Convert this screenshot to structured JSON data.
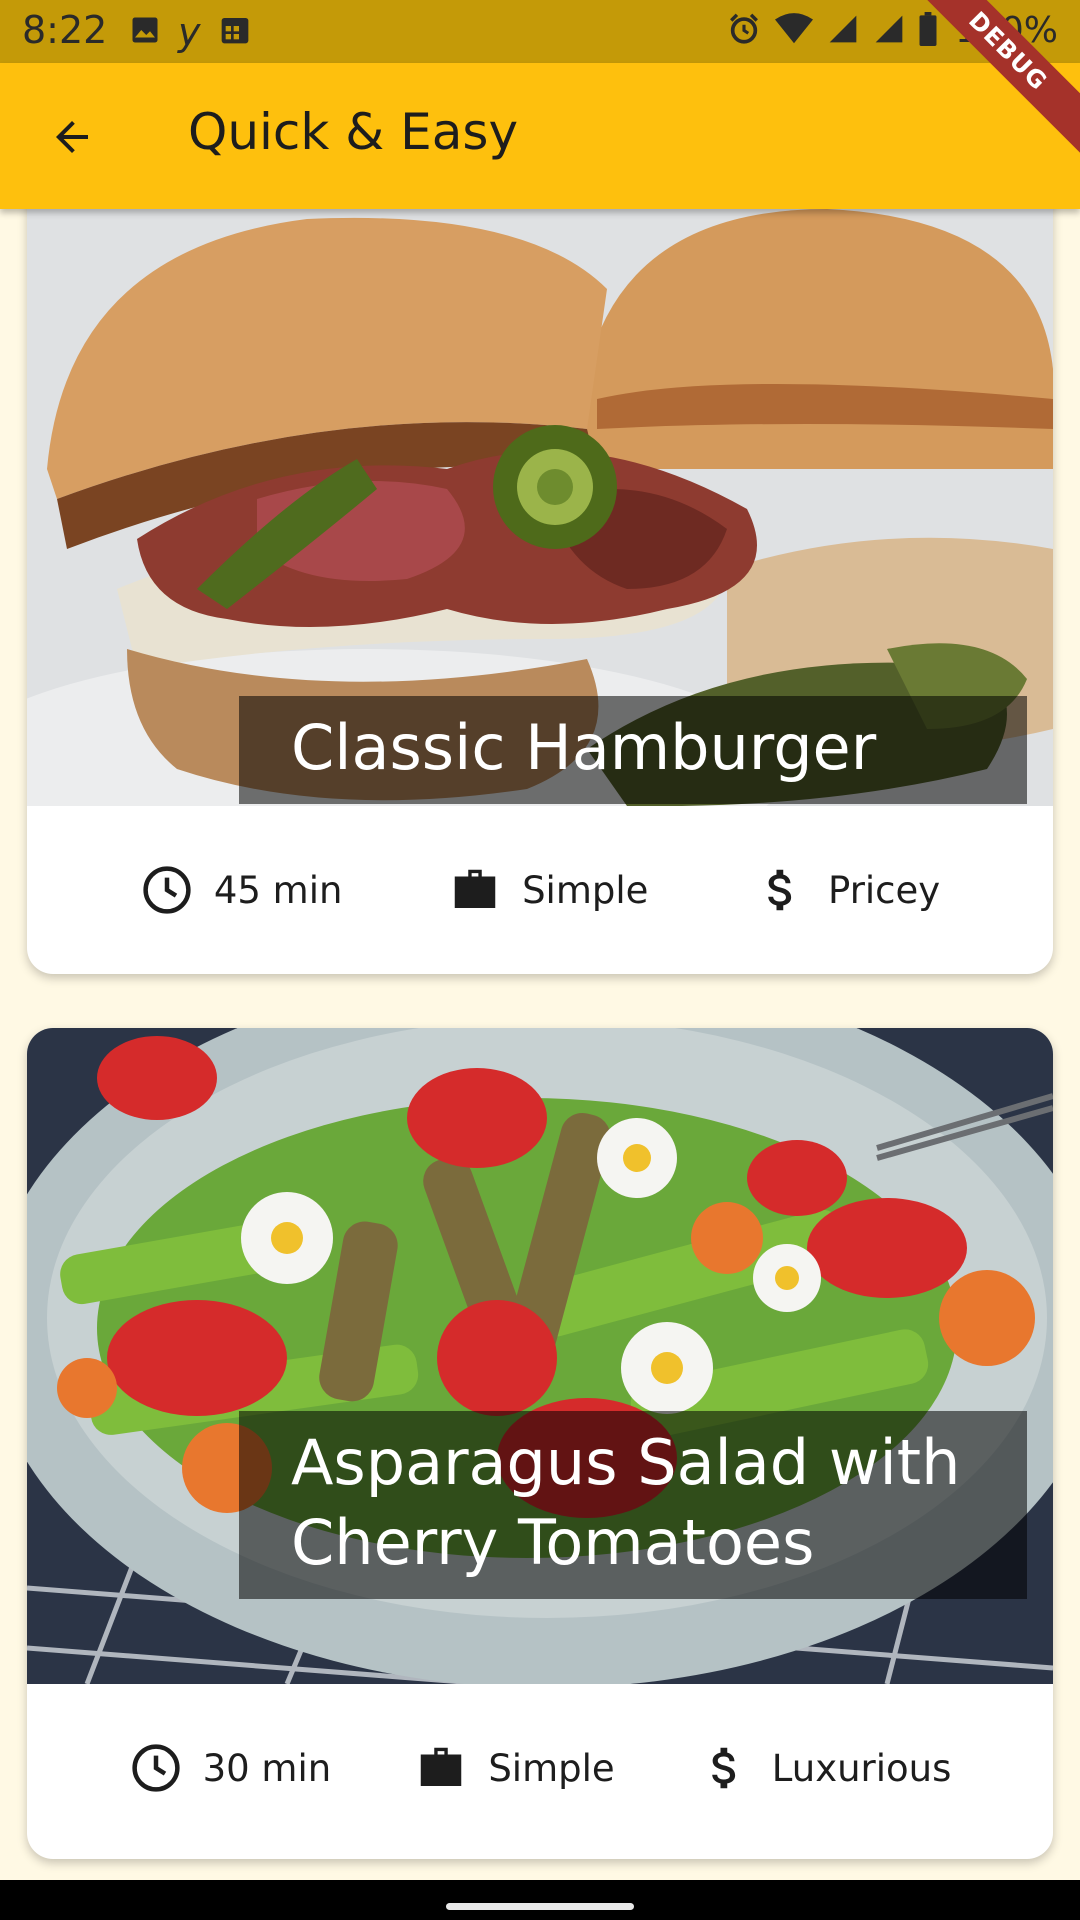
{
  "status_bar": {
    "time": "8:22",
    "battery_text": "100%",
    "left_icons": [
      "image-icon",
      "yahoo-icon",
      "calendar-icon"
    ],
    "right_icons": [
      "alarm-icon",
      "wifi-icon",
      "signal-icon",
      "signal-icon",
      "battery-icon"
    ]
  },
  "debug_banner": "DEBUG",
  "app_bar": {
    "title": "Quick & Easy",
    "back_icon": "arrow-back-icon",
    "background": "#fec00d"
  },
  "meals": [
    {
      "title": "Classic Hamburger",
      "duration": "45 min",
      "complexity": "Simple",
      "affordability": "Pricey",
      "image": "hamburger photo"
    },
    {
      "title": "Asparagus Salad with Cherry Tomatoes",
      "duration": "30 min",
      "complexity": "Simple",
      "affordability": "Luxurious",
      "image": "asparagus salad photo"
    }
  ],
  "colors": {
    "accent": "#fec00d",
    "status_bar": "#c49a08",
    "background": "#fff9e4",
    "debug_banner": "#a5322a"
  }
}
